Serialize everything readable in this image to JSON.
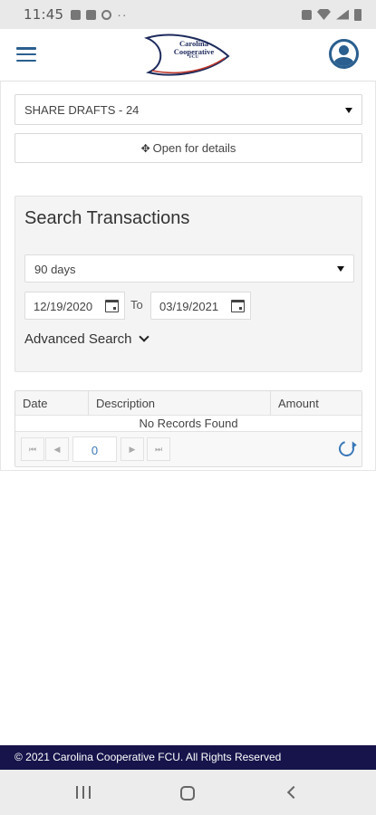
{
  "status_bar": {
    "time": "11:45",
    "dots": "··"
  },
  "header": {
    "logo": {
      "line1": "Carolina",
      "line2": "Cooperative",
      "line3": "FCU"
    }
  },
  "account": {
    "selected": "SHARE DRAFTS - 24"
  },
  "open_details_label": "Open for details",
  "search": {
    "title": "Search Transactions",
    "range": "90 days",
    "from_date": "12/19/2020",
    "to_label": "To",
    "to_date": "03/19/2021",
    "advanced_label": "Advanced Search"
  },
  "grid": {
    "columns": [
      "Date",
      "Description",
      "Amount"
    ],
    "empty_message": "No Records Found",
    "page": "0"
  },
  "footer": {
    "text": "© 2021 Carolina Cooperative FCU. All Rights Reserved"
  },
  "colors": {
    "brand_navy": "#16144a",
    "accent_blue": "#2a5f8f",
    "link_blue": "#3a78b8"
  }
}
